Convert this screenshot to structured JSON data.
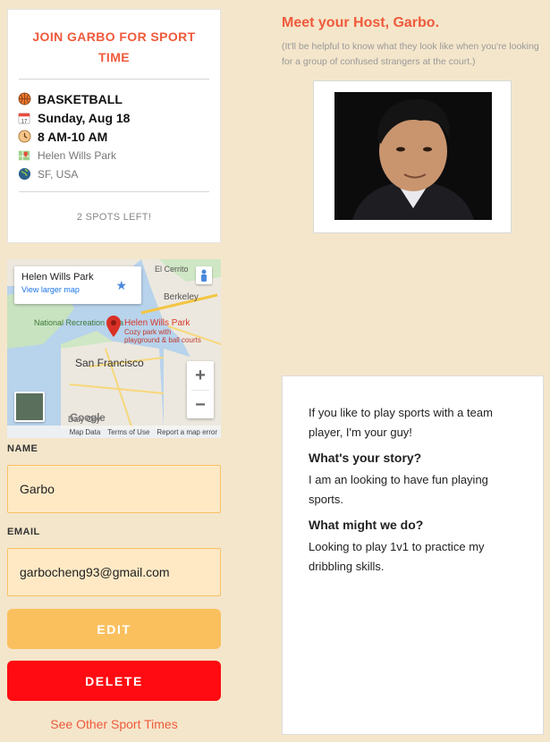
{
  "event": {
    "title": "JOIN GARBO FOR SPORT TIME",
    "sport": "BASKETBALL",
    "date": "Sunday, Aug 18",
    "time": "8 AM-10 AM",
    "location": "Helen Wills Park",
    "city": "SF, USA",
    "spots": "2 SPOTS LEFT!",
    "icons": [
      "basketball-icon",
      "calendar-icon",
      "clock-icon",
      "map-pin-icon",
      "globe-icon"
    ]
  },
  "map": {
    "info_place": "Helen Wills Park",
    "info_link": "View larger map",
    "pin_label": "Helen Wills Park",
    "pin_sub": "Cozy park with playground & ball courts",
    "labels": [
      "Berkeley",
      "El Cerrito",
      "National Recreation Area",
      "San Francisco",
      "Daly City"
    ],
    "logo": "Google",
    "footer": [
      "Map Data",
      "Terms of Use",
      "Report a map error"
    ],
    "zoom_in": "+",
    "zoom_out": "−"
  },
  "form": {
    "name_label": "NAME",
    "name_value": "Garbo",
    "email_label": "EMAIL",
    "email_value": "garbocheng93@gmail.com"
  },
  "actions": {
    "edit": "EDIT",
    "delete": "DELETE",
    "other_link": "See Other Sport Times"
  },
  "host": {
    "heading": "Meet your Host, Garbo.",
    "subtext": "(It'll be helpful to know what they look like when you're looking for a group of confused strangers at the court.)"
  },
  "bio": {
    "intro": "If you like to play sports with a team player, I'm your guy!",
    "q1": "What's your story?",
    "a1": "I am an looking to have fun playing sports.",
    "q2": "What might we do?",
    "a2": "Looking to play 1v1 to practice my dribbling skills."
  },
  "colors": {
    "accent": "#f05a3c",
    "edit": "#fac05e",
    "delete": "#ff0b11",
    "background": "#f4e6cb"
  }
}
